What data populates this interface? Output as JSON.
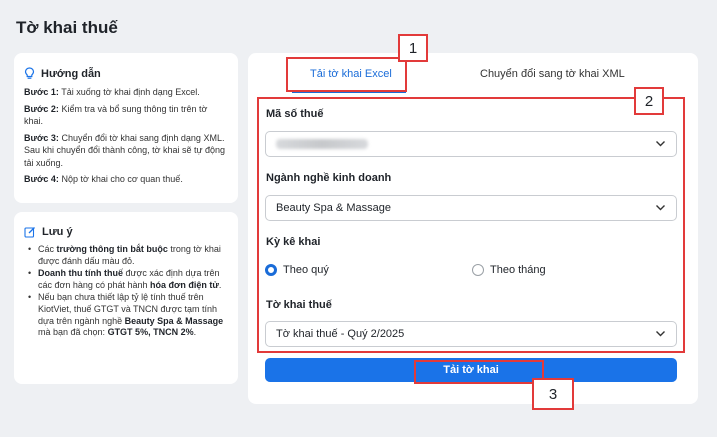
{
  "page": {
    "title": "Tờ khai thuế"
  },
  "guide": {
    "title": "Hướng dẫn",
    "steps": [
      {
        "label": "Bước 1:",
        "text": " Tải xuống tờ khai định dạng Excel."
      },
      {
        "label": "Bước 2:",
        "text": " Kiểm tra và bổ sung thông tin trên tờ khai."
      },
      {
        "label": "Bước 3:",
        "text": " Chuyển đổi tờ khai sang định dạng XML. Sau khi chuyển đổi thành công, tờ khai sẽ tự động tải xuống."
      },
      {
        "label": "Bước 4:",
        "text": " Nộp tờ khai cho cơ quan thuế."
      }
    ]
  },
  "note": {
    "title": "Lưu ý",
    "item1": {
      "a": "Các ",
      "b": "trường thông tin bắt buộc",
      "c": " trong tờ khai được đánh dấu màu đỏ."
    },
    "item2": {
      "a": "Doanh thu tính thuế",
      "b": " được xác định dựa trên các đơn hàng có phát hành ",
      "c": "hóa đơn điện tử",
      "d": "."
    },
    "item3": {
      "a": "Nếu bạn chưa thiết lập tỷ lệ tính thuế trên KiotViet, thuế GTGT và TNCN được tạm tính dựa trên ngành nghề ",
      "b": "Beauty Spa & Massage",
      "c": " mà bạn đã chọn: ",
      "d": "GTGT 5%, TNCN 2%",
      "e": "."
    }
  },
  "tabs": {
    "excel": "Tải tờ khai Excel",
    "xml": "Chuyển đổi sang tờ khai XML"
  },
  "form": {
    "tax_code_label": "Mã số thuế",
    "industry_label": "Ngành nghề kinh doanh",
    "industry_value": "Beauty Spa & Massage",
    "period_label": "Kỳ kê khai",
    "period_quarter": "Theo quý",
    "period_month": "Theo tháng",
    "period_selected": "quarter",
    "declaration_label": "Tờ khai thuế",
    "declaration_value": "Tờ khai thuế - Quý 2/2025",
    "download_button": "Tải tờ khai"
  },
  "annotations": {
    "badge1": "1",
    "badge2": "2",
    "badge3": "3"
  },
  "colors": {
    "accent": "#1a73e8",
    "annotation": "#e23a3a"
  },
  "icons": {
    "guide": "lightbulb-icon",
    "note": "edit-icon",
    "select": "chevron-down-icon"
  }
}
